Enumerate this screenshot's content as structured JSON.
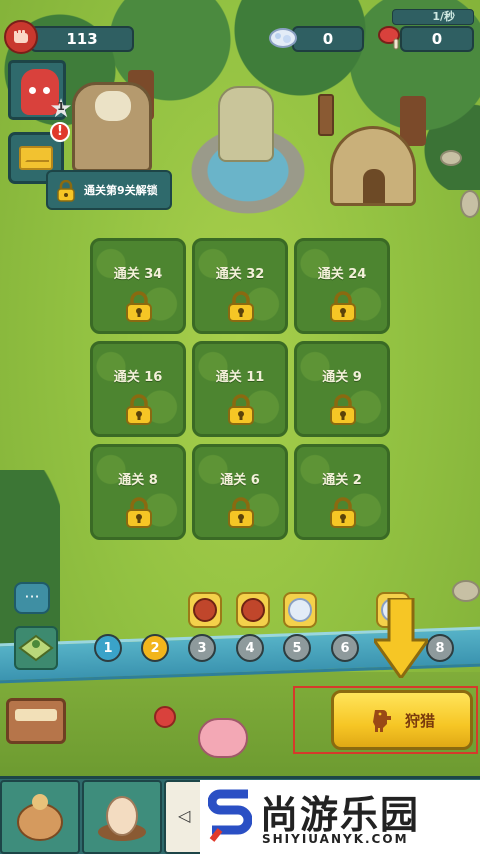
{
  "resources": {
    "meat_count": "113",
    "crystal_count": "0",
    "food_count": "0",
    "rate": "1/秒"
  },
  "player": {
    "level": "1",
    "alert": "!"
  },
  "unlock_banner": "通关第9关解锁",
  "locked_slots": [
    {
      "label": "通关 34"
    },
    {
      "label": "通关 32"
    },
    {
      "label": "通关 24"
    },
    {
      "label": "通关 16"
    },
    {
      "label": "通关 11"
    },
    {
      "label": "通关 9"
    },
    {
      "label": "通关 8"
    },
    {
      "label": "通关 6"
    },
    {
      "label": "通关 2"
    }
  ],
  "stages": [
    {
      "num": "1",
      "state": "done"
    },
    {
      "num": "2",
      "state": "current"
    },
    {
      "num": "3",
      "state": "locked"
    },
    {
      "num": "4",
      "state": "locked"
    },
    {
      "num": "5",
      "state": "locked"
    },
    {
      "num": "6",
      "state": "locked"
    },
    {
      "num": "8",
      "state": "locked"
    }
  ],
  "hunt_button": "狩猎",
  "watermark": {
    "cn": "尚游乐园",
    "en": "SHIYIUANYK.COM"
  },
  "colors": {
    "stage_done": "#3aa3c9",
    "stage_current": "#f2b51c",
    "stage_locked": "#8e9a9c",
    "hunt_yellow": "#f6c625",
    "highlight_frame": "#d63a2b"
  }
}
